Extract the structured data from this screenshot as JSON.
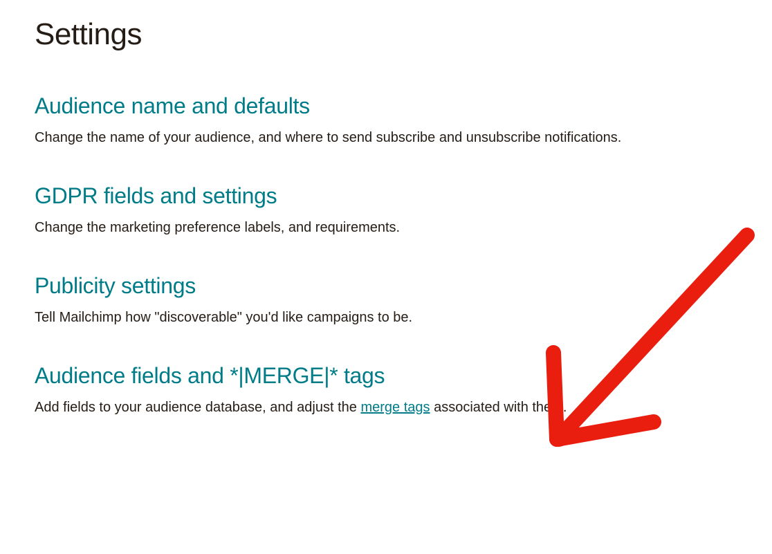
{
  "page": {
    "title": "Settings"
  },
  "sections": [
    {
      "title": "Audience name and defaults",
      "description": "Change the name of your audience, and where to send subscribe and unsubscribe notifications."
    },
    {
      "title": "GDPR fields and settings",
      "description": "Change the marketing preference labels, and requirements."
    },
    {
      "title": "Publicity settings",
      "description": "Tell Mailchimp how \"discoverable\" you'd like campaigns to be."
    },
    {
      "title": "Audience fields and *|MERGE|* tags",
      "description_pre": "Add fields to your audience database, and adjust the ",
      "description_link": "merge tags",
      "description_post": " associated with them."
    }
  ],
  "annotation": {
    "arrow_color": "#e91e0f"
  }
}
